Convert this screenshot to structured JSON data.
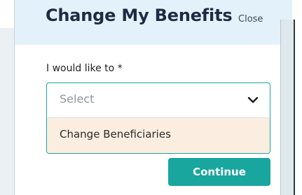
{
  "modal": {
    "title": "Change My Benefits",
    "close_label": "Close",
    "field_label": "I would like to *",
    "select": {
      "placeholder": "Select",
      "options": [
        "Change Beneficiaries"
      ]
    },
    "continue_label": "Continue"
  },
  "icons": {
    "chevron": "chevron-down-icon"
  },
  "colors": {
    "accent": "#18a69e",
    "header_bg": "#e3f2fa",
    "option_highlight": "#fbeee0",
    "title": "#1f2a44",
    "frame": "#17756f"
  }
}
